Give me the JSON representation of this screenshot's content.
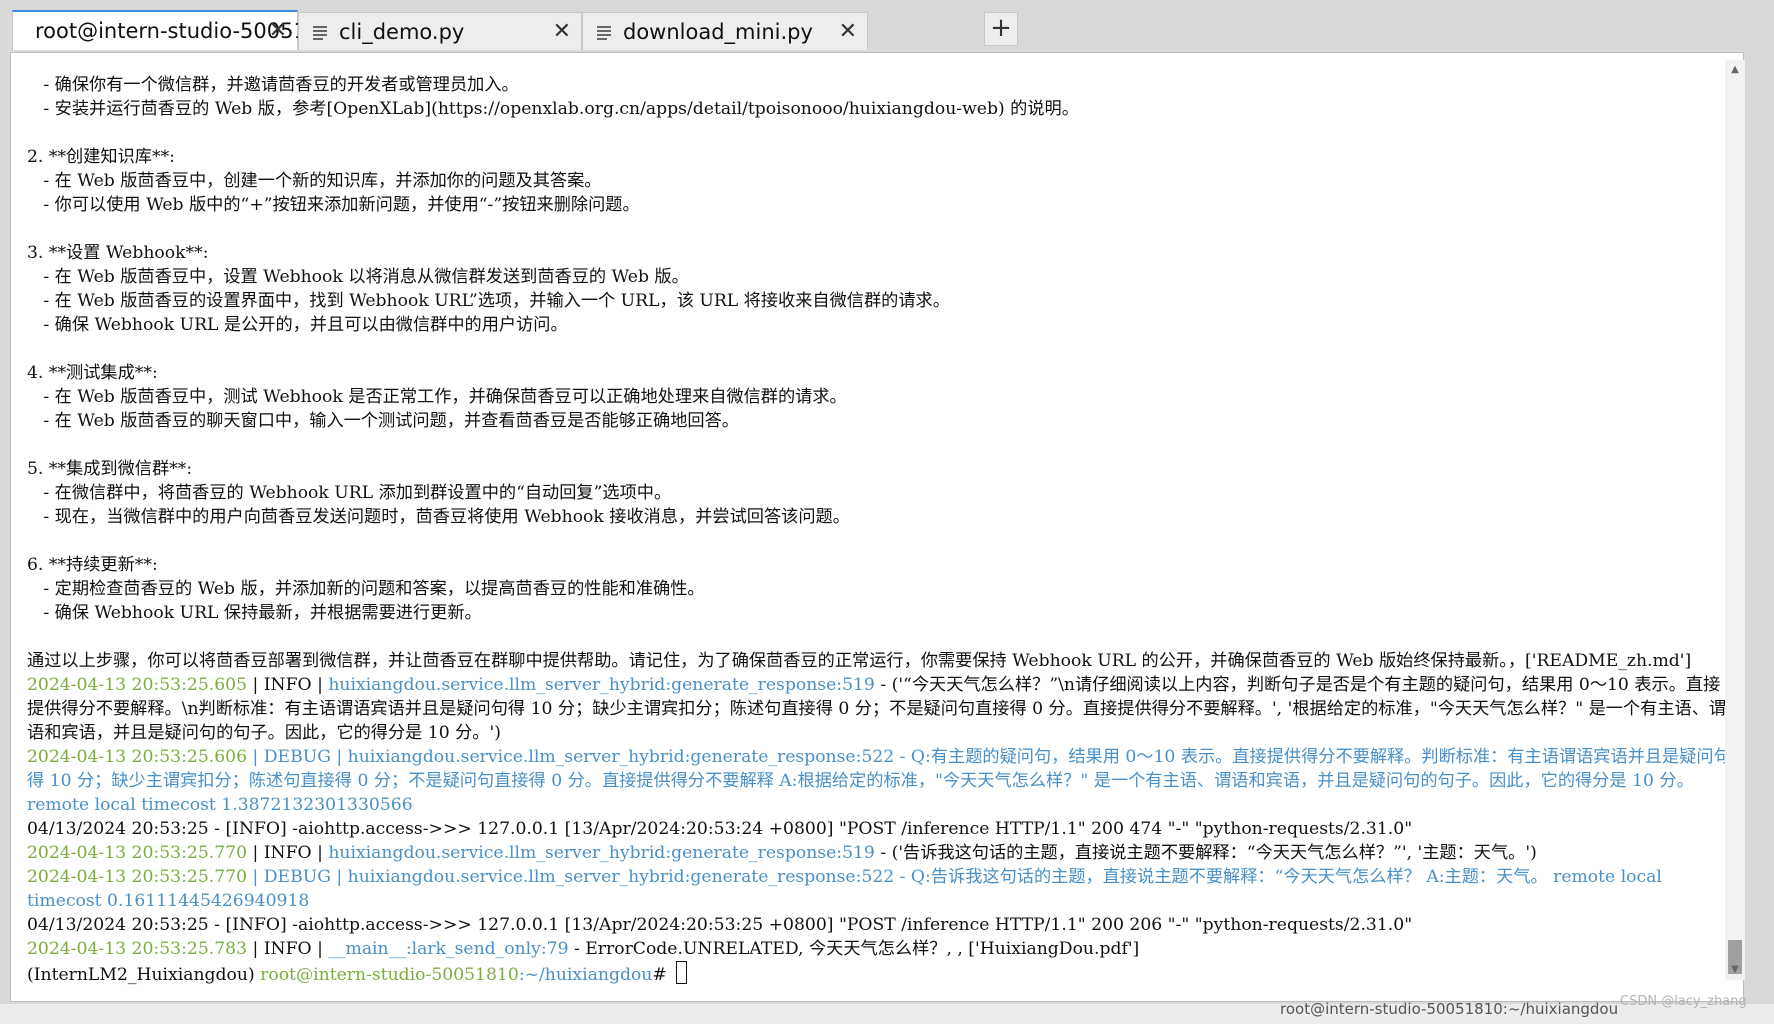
{
  "tabs": [
    {
      "label": "root@intern-studio-50051",
      "active": true
    },
    {
      "label": "cli_demo.py",
      "active": false
    },
    {
      "label": "download_mini.py",
      "active": false
    }
  ],
  "new_tab_label": "+",
  "close_glyph": "✕",
  "terminal": {
    "l01": "   - 确保你有一个微信群，并邀请茴香豆的开发者或管理员加入。",
    "l02": "   - 安装并运行茴香豆的 Web 版，参考[OpenXLab](https://openxlab.org.cn/apps/detail/tpoisonooo/huixiangdou-web) 的说明。",
    "l03": "2. **创建知识库**:",
    "l04": "   - 在 Web 版茴香豆中，创建一个新的知识库，并添加你的问题及其答案。",
    "l05": "   - 你可以使用 Web 版中的“+”按钮来添加新问题，并使用“-”按钮来删除问题。",
    "l06": "3. **设置 Webhook**:",
    "l07": "   - 在 Web 版茴香豆中，设置 Webhook 以将消息从微信群发送到茴香豆的 Web 版。",
    "l08": "   - 在 Web 版茴香豆的设置界面中，找到 Webhook URL”选项，并输入一个 URL，该 URL 将接收来自微信群的请求。",
    "l09": "   - 确保 Webhook URL 是公开的，并且可以由微信群中的用户访问。",
    "l10": "4. **测试集成**:",
    "l11": "   - 在 Web 版茴香豆中，测试 Webhook 是否正常工作，并确保茴香豆可以正确地处理来自微信群的请求。",
    "l12": "   - 在 Web 版茴香豆的聊天窗口中，输入一个测试问题，并查看茴香豆是否能够正确地回答。",
    "l13": "5. **集成到微信群**:",
    "l14": "   - 在微信群中，将茴香豆的 Webhook URL 添加到群设置中的“自动回复”选项中。",
    "l15": "   - 现在，当微信群中的用户向茴香豆发送问题时，茴香豆将使用 Webhook 接收消息，并尝试回答该问题。",
    "l16": "6. **持续更新**:",
    "l17": "   - 定期检查茴香豆的 Web 版，并添加新的问题和答案，以提高茴香豆的性能和准确性。",
    "l18": "   - 确保 Webhook URL 保持最新，并根据需要进行更新。",
    "l19": "通过以上步骤，你可以将茴香豆部署到微信群，并让茴香豆在群聊中提供帮助。请记住，为了确保茴香豆的正常运行，你需要保持 Webhook URL 的公开，并确保茴香豆的 Web 版始终保持最新。，['README_zh.md']",
    "log1_time": "2024-04-13 20:53:25.605",
    "log1_level": "INFO",
    "log1_src": "huixiangdou.service.llm_server_hybrid:generate_response:519",
    "log1_msg": " - ('“今天天气怎么样？”\\n请仔细阅读以上内容，判断句子是否是个有主题的疑问句，结果用 0～10 表示。直接提供得分不要解释。\\n判断标准：有主语谓语宾语并且是疑问句得 10 分；缺少主谓宾扣分；陈述句直接得 0 分；不是疑问句直接得 0 分。直接提供得分不要解释。', '根据给定的标准，\"今天天气怎么样？\" 是一个有主语、谓语和宾语，并且是疑问句的句子。因此，它的得分是 10 分。')",
    "log2_time": "2024-04-13 20:53:25.606",
    "log2_level": "DEBUG",
    "log2_src": "huixiangdou.service.llm_server_hybrid:generate_response:522",
    "log2_msg": " - Q:有主题的疑问句，结果用 0～10 表示。直接提供得分不要解释。判断标准：有主语谓语宾语并且是疑问句得 10 分；缺少主谓宾扣分；陈述句直接得 0 分；不是疑问句直接得 0 分。直接提供得分不要解释 A:根据给定的标准，\"今天天气怎么样？\" 是一个有主语、谓语和宾语，并且是疑问句的句子。因此，它的得分是 10 分。        remote local timecost 1.3872132301330566",
    "access1": "04/13/2024 20:53:25 - [INFO] -aiohttp.access->>>      127.0.0.1 [13/Apr/2024:20:53:24 +0800] \"POST /inference HTTP/1.1\" 200 474 \"-\" \"python-requests/2.31.0\"",
    "log3_time": "2024-04-13 20:53:25.770",
    "log3_level": "INFO",
    "log3_src": "huixiangdou.service.llm_server_hybrid:generate_response:519",
    "log3_msg": " - ('告诉我这句话的主题，直接说主题不要解释：“今天天气怎么样？”', '主题：天气。')",
    "log4_time": "2024-04-13 20:53:25.770",
    "log4_level": "DEBUG",
    "log4_src": "huixiangdou.service.llm_server_hybrid:generate_response:522",
    "log4_msg": " - Q:告诉我这句话的主题，直接说主题不要解释：“今天天气怎么样？ A:主题：天气。                   remote local timecost 0.16111445426940918",
    "access2": "04/13/2024 20:53:25 - [INFO] -aiohttp.access->>>      127.0.0.1 [13/Apr/2024:20:53:25 +0800] \"POST /inference HTTP/1.1\" 200 206 \"-\" \"python-requests/2.31.0\"",
    "log5_time": "2024-04-13 20:53:25.783",
    "log5_level": "INFO",
    "log5_src": "__main__:lark_send_only:79",
    "log5_msg": " - ErrorCode.UNRELATED, 今天天气怎么样？, , ['HuixiangDou.pdf']",
    "prompt_env": "(InternLM2_Huixiangdou) ",
    "prompt_host": "root@intern-studio-50051810",
    "prompt_path": ":~/huixiangdou",
    "prompt_sign": "# "
  },
  "status_text": "root@intern-studio-50051810:~/huixiangdou",
  "watermark": "CSDN @lacy_zhang"
}
